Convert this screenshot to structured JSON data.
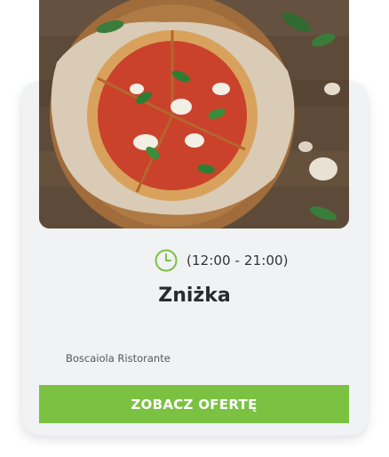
{
  "offer": {
    "hours": "(12:00 - 21:00)",
    "title": "Zniżka",
    "restaurant": "Boscaiola Ristorante",
    "cta_label": "ZOBACZ OFERTĘ"
  },
  "icons": {
    "clock": "clock-icon"
  },
  "colors": {
    "accent": "#7bc242",
    "card_background": "#f1f2f4",
    "text_dark": "#2b2b2b"
  }
}
